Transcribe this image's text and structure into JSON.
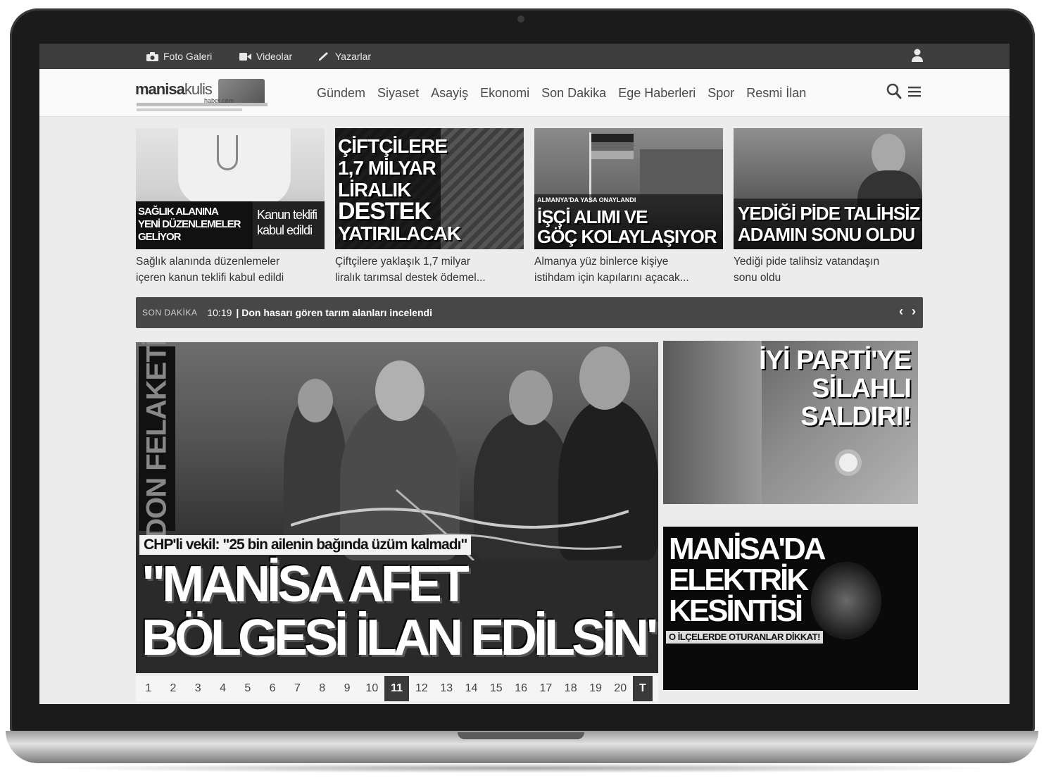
{
  "topbar": {
    "links": [
      "Foto Galeri",
      "Videolar",
      "Yazarlar"
    ]
  },
  "header": {
    "logo_main": "manisa",
    "logo_accent": "kulis",
    "logo_tld": "haber.com",
    "nav": [
      "Gündem",
      "Siyaset",
      "Asayiş",
      "Ekonomi",
      "Son Dakika",
      "Ege Haberleri",
      "Spor",
      "Resmi İlan"
    ]
  },
  "cards": [
    {
      "overlay_left": [
        "SAĞLIK ALANINA",
        "YENİ DÜZENLEMELER",
        "GELİYOR"
      ],
      "overlay_right": [
        "Kanun teklifi",
        "kabul edildi"
      ],
      "caption": [
        "Sağlık alanında düzenlemeler",
        "içeren kanun teklifi kabul edildi"
      ]
    },
    {
      "overlay": [
        "ÇİFTÇİLERE",
        "1,7 MİLYAR",
        "LİRALIK",
        "DESTEK",
        "YATIRILACAK"
      ],
      "caption": [
        "Çiftçilere yaklaşık 1,7 milyar",
        "liralık tarımsal destek ödemel..."
      ]
    },
    {
      "overlay_small": "ALMANYA'DA YASA ONAYLANDI",
      "overlay": [
        "İŞÇİ ALIMI VE",
        "GÖÇ KOLAYLAŞIYOR"
      ],
      "caption": [
        "Almanya yüz binlerce kişiye",
        "istihdam için kapılarını açacak..."
      ]
    },
    {
      "overlay": [
        "YEDİĞİ PİDE TALİHSİZ",
        "ADAMIN SONU OLDU"
      ],
      "caption": [
        "Yediği pide talihsiz vatandaşın",
        "sonu oldu"
      ]
    }
  ],
  "ticker": {
    "label": "SON DAKİKA",
    "time": "10:19",
    "headline": "| Don hasarı gören tarım alanları incelendi",
    "prev": "‹",
    "next": "›"
  },
  "slider": {
    "vertical_title": "DON FELAKETİ",
    "subtitle": "CHP'li vekil: \"25 bin ailenin bağında üzüm kalmadı\"",
    "headline_line1": "\"MANİSA AFET",
    "headline_line2": "BÖLGESİ İLAN EDİLSİN\"",
    "pages": [
      "1",
      "2",
      "3",
      "4",
      "5",
      "6",
      "7",
      "8",
      "9",
      "10",
      "11",
      "12",
      "13",
      "14",
      "15",
      "16",
      "17",
      "18",
      "19",
      "20"
    ],
    "active_page": "11",
    "last_label": "T"
  },
  "side_banners": [
    {
      "lines": [
        "İYİ PARTİ'YE",
        "SİLAHLI",
        "SALDIRI!"
      ]
    },
    {
      "lines": [
        "MANİSA'DA",
        "ELEKTRİK",
        "KESİNTİSİ"
      ],
      "tag": "O İLÇELERDE OTURANLAR DİKKAT!"
    }
  ]
}
